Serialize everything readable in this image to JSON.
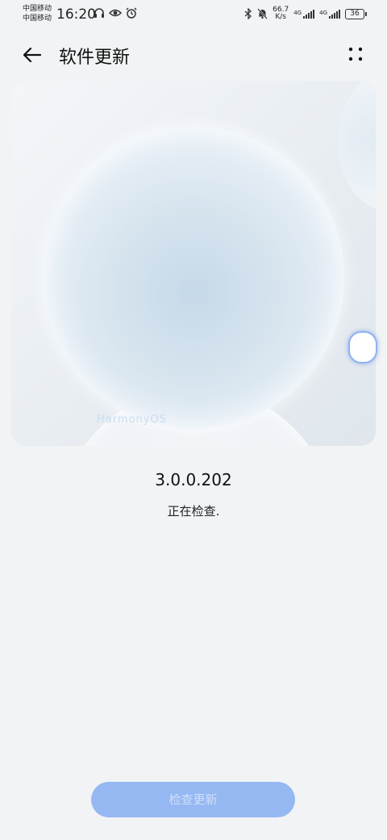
{
  "status_bar": {
    "carrier_1": "中国移动",
    "carrier_2": "中国移动",
    "time": "16:20",
    "speed_value": "66.7",
    "speed_unit": "K/s",
    "net_1": "4G",
    "net_2": "4G",
    "battery": "36"
  },
  "app_bar": {
    "title": "软件更新"
  },
  "hero": {
    "watermark": "HarmonyOS"
  },
  "version": "3.0.0.202",
  "status_text": "正在检查.",
  "check_button": {
    "label": "检查更新",
    "enabled": false
  },
  "colors": {
    "background": "#f1f3f5",
    "button_disabled": "#95b7f2",
    "button_text_disabled": "#cfe0fa"
  }
}
